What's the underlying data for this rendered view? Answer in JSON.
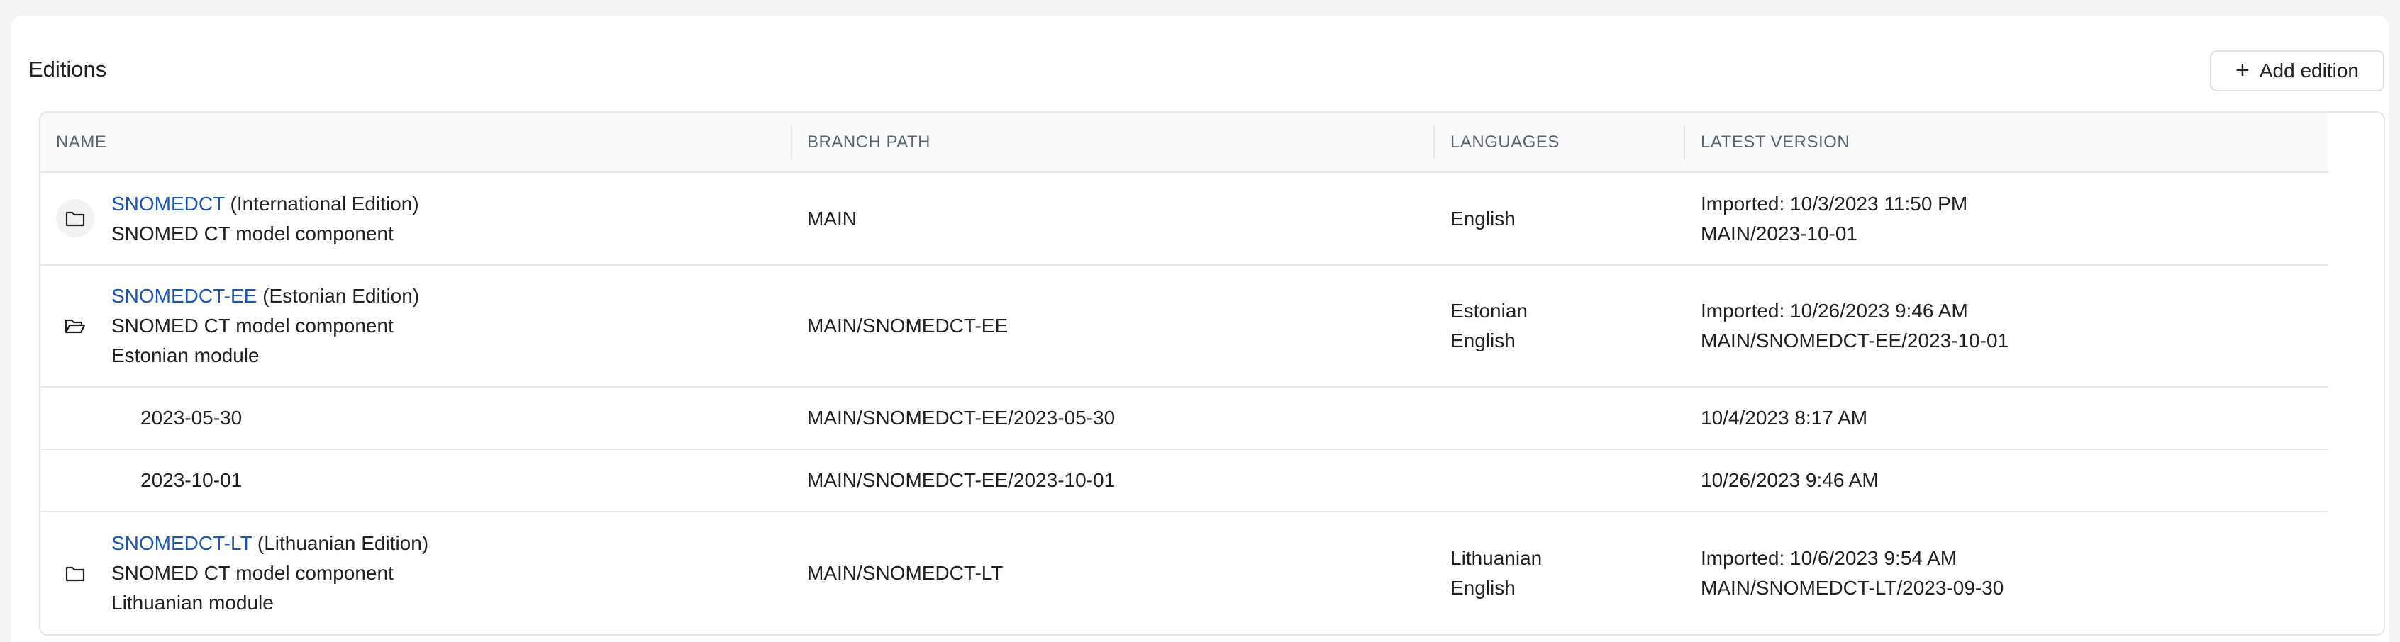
{
  "card": {
    "title": "Editions",
    "add_button_label": "Add edition",
    "add_button_icon": "plus-icon"
  },
  "table": {
    "columns": [
      "NAME",
      "BRANCH PATH",
      "LANGUAGES",
      "LATEST VERSION"
    ],
    "rows": [
      {
        "icon": "folder-icon",
        "short_name": "SNOMEDCT",
        "edition": " (International Edition)",
        "lines": [
          "SNOMED CT model component"
        ],
        "branch_path": "MAIN",
        "languages": [
          "English"
        ],
        "latest_version": [
          "Imported: 10/3/2023 11:50 PM",
          "MAIN/2023-10-01"
        ]
      },
      {
        "icon": "folder-open-icon",
        "short_name": "SNOMEDCT-EE",
        "edition": " (Estonian Edition)",
        "lines": [
          "SNOMED CT model component",
          "Estonian module"
        ],
        "branch_path": "MAIN/SNOMEDCT-EE",
        "languages": [
          "Estonian",
          "English"
        ],
        "latest_version": [
          "Imported: 10/26/2023 9:46 AM",
          "MAIN/SNOMEDCT-EE/2023-10-01"
        ]
      },
      {
        "version": "2023-05-30",
        "branch_path": "MAIN/SNOMEDCT-EE/2023-05-30",
        "date": "10/4/2023 8:17 AM"
      },
      {
        "version": "2023-10-01",
        "branch_path": "MAIN/SNOMEDCT-EE/2023-10-01",
        "date": "10/26/2023 9:46 AM"
      },
      {
        "icon": "folder-icon",
        "short_name": "SNOMEDCT-LT",
        "edition": " (Lithuanian Edition)",
        "lines": [
          "SNOMED CT model component",
          "Lithuanian module"
        ],
        "branch_path": "MAIN/SNOMEDCT-LT",
        "languages": [
          "Lithuanian",
          "English"
        ],
        "latest_version": [
          "Imported: 10/6/2023 9:54 AM",
          "MAIN/SNOMEDCT-LT/2023-09-30"
        ]
      }
    ]
  },
  "colors": {
    "link": "#1a56b4",
    "border": "#e3e5e8",
    "header_bg": "#f8f9fa"
  }
}
